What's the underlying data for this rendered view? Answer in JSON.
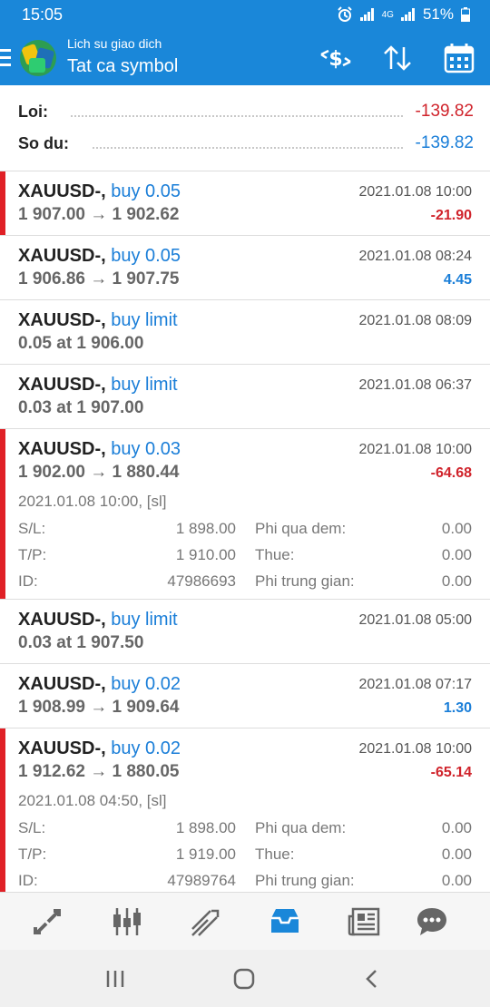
{
  "status": {
    "time": "15:05",
    "battery": "51%",
    "network": "4G"
  },
  "header": {
    "subtitle": "Lich su giao dich",
    "title": "Tat ca symbol"
  },
  "summary": {
    "profit_label": "Loi:",
    "profit_value": "-139.82",
    "balance_label": "So du:",
    "balance_value": "-139.82"
  },
  "details_labels": {
    "sl": "S/L:",
    "tp": "T/P:",
    "id": "ID:",
    "swap": "Phi qua dem:",
    "tax": "Thue:",
    "commission": "Phi trung gian:"
  },
  "trades": [
    {
      "symbol": "XAUUSD-,",
      "type": "buy 0.05",
      "date": "2021.01.08 10:00",
      "prices": "1 907.00 → 1 902.62",
      "profit": "-21.90",
      "profit_color": "#d0232b",
      "marked": true
    },
    {
      "symbol": "XAUUSD-,",
      "type": "buy 0.05",
      "date": "2021.01.08 08:24",
      "prices": "1 906.86 → 1 907.75",
      "profit": "4.45",
      "profit_color": "#1a7ed8",
      "marked": false
    },
    {
      "symbol": "XAUUSD-,",
      "type": "buy limit",
      "date": "2021.01.08 08:09",
      "prices": "0.05 at 1 906.00",
      "profit": "",
      "marked": false
    },
    {
      "symbol": "XAUUSD-,",
      "type": "buy limit",
      "date": "2021.01.08 06:37",
      "prices": "0.03 at 1 907.00",
      "profit": "",
      "marked": false
    },
    {
      "symbol": "XAUUSD-,",
      "type": "buy 0.03",
      "date": "2021.01.08 10:00",
      "prices": "1 902.00 → 1 880.44",
      "profit": "-64.68",
      "profit_color": "#d0232b",
      "marked": true,
      "open_info": "2021.01.08 10:00, [sl]",
      "sl": "1 898.00",
      "tp": "1 910.00",
      "id": "47986693",
      "swap": "0.00",
      "tax": "0.00",
      "commission": "0.00"
    },
    {
      "symbol": "XAUUSD-,",
      "type": "buy limit",
      "date": "2021.01.08 05:00",
      "prices": "0.03 at 1 907.50",
      "profit": "",
      "marked": false
    },
    {
      "symbol": "XAUUSD-,",
      "type": "buy 0.02",
      "date": "2021.01.08 07:17",
      "prices": "1 908.99 → 1 909.64",
      "profit": "1.30",
      "profit_color": "#1a7ed8",
      "marked": false
    },
    {
      "symbol": "XAUUSD-,",
      "type": "buy 0.02",
      "date": "2021.01.08 10:00",
      "prices": "1 912.62 → 1 880.05",
      "profit": "-65.14",
      "profit_color": "#d0232b",
      "marked": true,
      "open_info": "2021.01.08 04:50, [sl]",
      "sl": "1 898.00",
      "tp": "1 919.00",
      "id": "47989764",
      "swap": "0.00",
      "tax": "0.00",
      "commission": "0.00"
    }
  ],
  "bottom_nav": [
    "quotes-icon",
    "chart-icon",
    "trade-icon",
    "history-icon",
    "news-icon",
    "chat-icon"
  ],
  "colors": {
    "accent": "#1a87d9",
    "negative": "#d0232b",
    "positive": "#1a7ed8",
    "marker": "#e02026"
  }
}
